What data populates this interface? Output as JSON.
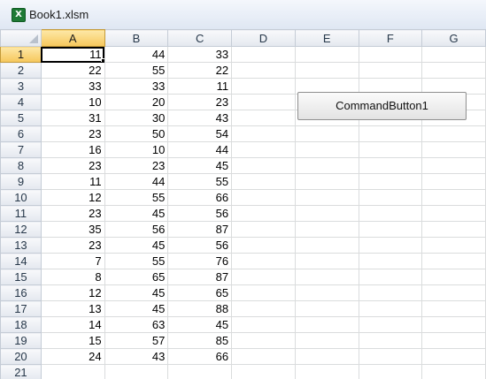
{
  "window": {
    "title": "Book1.xlsm",
    "icon": "excel-icon",
    "icon_glyph": "X"
  },
  "sheet": {
    "columns": [
      "A",
      "B",
      "C",
      "D",
      "E",
      "F",
      "G"
    ],
    "rows": [
      "1",
      "2",
      "3",
      "4",
      "5",
      "6",
      "7",
      "8",
      "9",
      "10",
      "11",
      "12",
      "13",
      "14",
      "15",
      "16",
      "17",
      "18",
      "19",
      "20",
      "21"
    ],
    "selected_cell": "A1",
    "cells": [
      [
        "11",
        "44",
        "33"
      ],
      [
        "22",
        "55",
        "22"
      ],
      [
        "33",
        "33",
        "11"
      ],
      [
        "10",
        "20",
        "23"
      ],
      [
        "31",
        "30",
        "43"
      ],
      [
        "23",
        "50",
        "54"
      ],
      [
        "16",
        "10",
        "44"
      ],
      [
        "23",
        "23",
        "45"
      ],
      [
        "11",
        "44",
        "55"
      ],
      [
        "12",
        "55",
        "66"
      ],
      [
        "23",
        "45",
        "56"
      ],
      [
        "35",
        "56",
        "87"
      ],
      [
        "23",
        "45",
        "56"
      ],
      [
        "7",
        "55",
        "76"
      ],
      [
        "8",
        "65",
        "87"
      ],
      [
        "12",
        "45",
        "65"
      ],
      [
        "13",
        "45",
        "88"
      ],
      [
        "14",
        "63",
        "45"
      ],
      [
        "15",
        "57",
        "85"
      ],
      [
        "24",
        "43",
        "66"
      ],
      [
        "",
        "",
        ""
      ]
    ]
  },
  "command_button": {
    "label": "CommandButton1"
  },
  "colors": {
    "selected_header": "#f6c75b",
    "grid_line": "#dadcdd",
    "header_bg": "#e4e8ef"
  }
}
